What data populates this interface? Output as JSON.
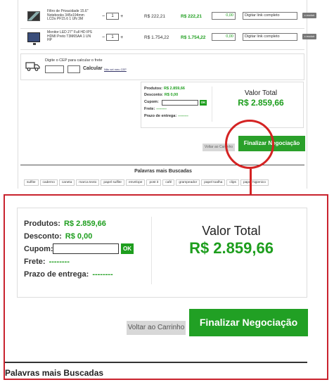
{
  "cart": {
    "rows": [
      {
        "name": "Filtro de Privacidade 15.6\" Notebooks 345x194mm LCDs PF15.6 1 UN 3M",
        "qty": "1",
        "unit_price": "R$ 222,21",
        "total": "R$ 222,21",
        "discount": "0,00",
        "link_placeholder": "Digitar link completo",
        "exclude": "x excluir"
      },
      {
        "name": "Monitor LED 27\" Full HD IPS HDMI Preto T3M65AA 1 UN HP",
        "qty": "1",
        "unit_price": "R$ 1.754,22",
        "total": "R$ 1.754,22",
        "discount": "0,00",
        "link_placeholder": "Digitar link completo",
        "exclude": "x excluir"
      }
    ],
    "qty_minus": "−",
    "qty_plus": "+"
  },
  "freight": {
    "label": "Digite o CEP para calcular o frete",
    "calculate": "Calcular",
    "no_cep": "Não sei meu CEP"
  },
  "summary": {
    "products_label": "Produtos:",
    "products_value": "R$ 2.859,66",
    "discount_label": "Desconto:",
    "discount_value": "R$ 0,00",
    "coupon_label": "Cupom:",
    "coupon_ok": "OK",
    "freight_label": "Frete:",
    "freight_value": "--------",
    "deadline_label": "Prazo de entrega:",
    "deadline_value": "--------",
    "total_label": "Valor Total",
    "total_value": "R$ 2.859,66"
  },
  "actions": {
    "back": "Voltar ao Carrinho",
    "finalize": "Finalizar Negociação"
  },
  "popular": {
    "title": "Palavras mais Buscadas",
    "tags": [
      "sulfite",
      "caderno",
      "caneta",
      "marca texto",
      "papel sulfite",
      "envelope",
      "post it",
      "café",
      "grampeador",
      "papel toalha",
      "clips",
      "papel higienico"
    ]
  },
  "colors": {
    "green": "#1e9e1e",
    "highlight_red": "#c9232e"
  }
}
